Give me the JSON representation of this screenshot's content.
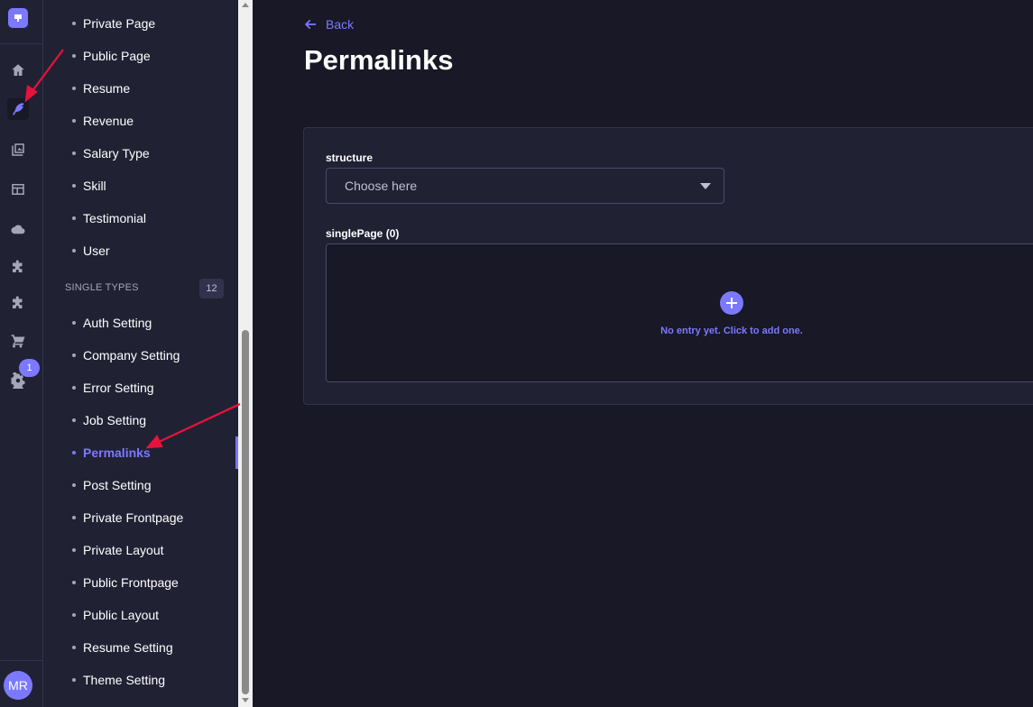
{
  "rail": {
    "icons": [
      "logo-icon",
      "home-icon",
      "content-manager-icon",
      "media-library-icon",
      "layout-icon",
      "cloud-icon",
      "plugin-icon",
      "puzzle-icon",
      "cart-icon",
      "settings-icon"
    ],
    "settings_badge": "1",
    "avatar_initials": "MR"
  },
  "subnav": {
    "collection_items": [
      "Private Page",
      "Public Page",
      "Resume",
      "Revenue",
      "Salary Type",
      "Skill",
      "Testimonial",
      "User"
    ],
    "single_types_label": "SINGLE TYPES",
    "single_types_count": "12",
    "single_items": [
      "Auth Setting",
      "Company Setting",
      "Error Setting",
      "Job Setting",
      "Permalinks",
      "Post Setting",
      "Private Frontpage",
      "Private Layout",
      "Public Frontpage",
      "Public Layout",
      "Resume Setting",
      "Theme Setting"
    ],
    "active_item": "Permalinks"
  },
  "header": {
    "back_label": "Back",
    "title": "Permalinks"
  },
  "form": {
    "structure_label": "structure",
    "structure_placeholder": "Choose here",
    "single_page_label": "singlePage (0)",
    "empty_message": "No entry yet. Click to add one."
  },
  "colors": {
    "accent": "#7b79ff",
    "background": "#181826",
    "panel": "#212134",
    "annotation_arrow": "#e8133a"
  }
}
